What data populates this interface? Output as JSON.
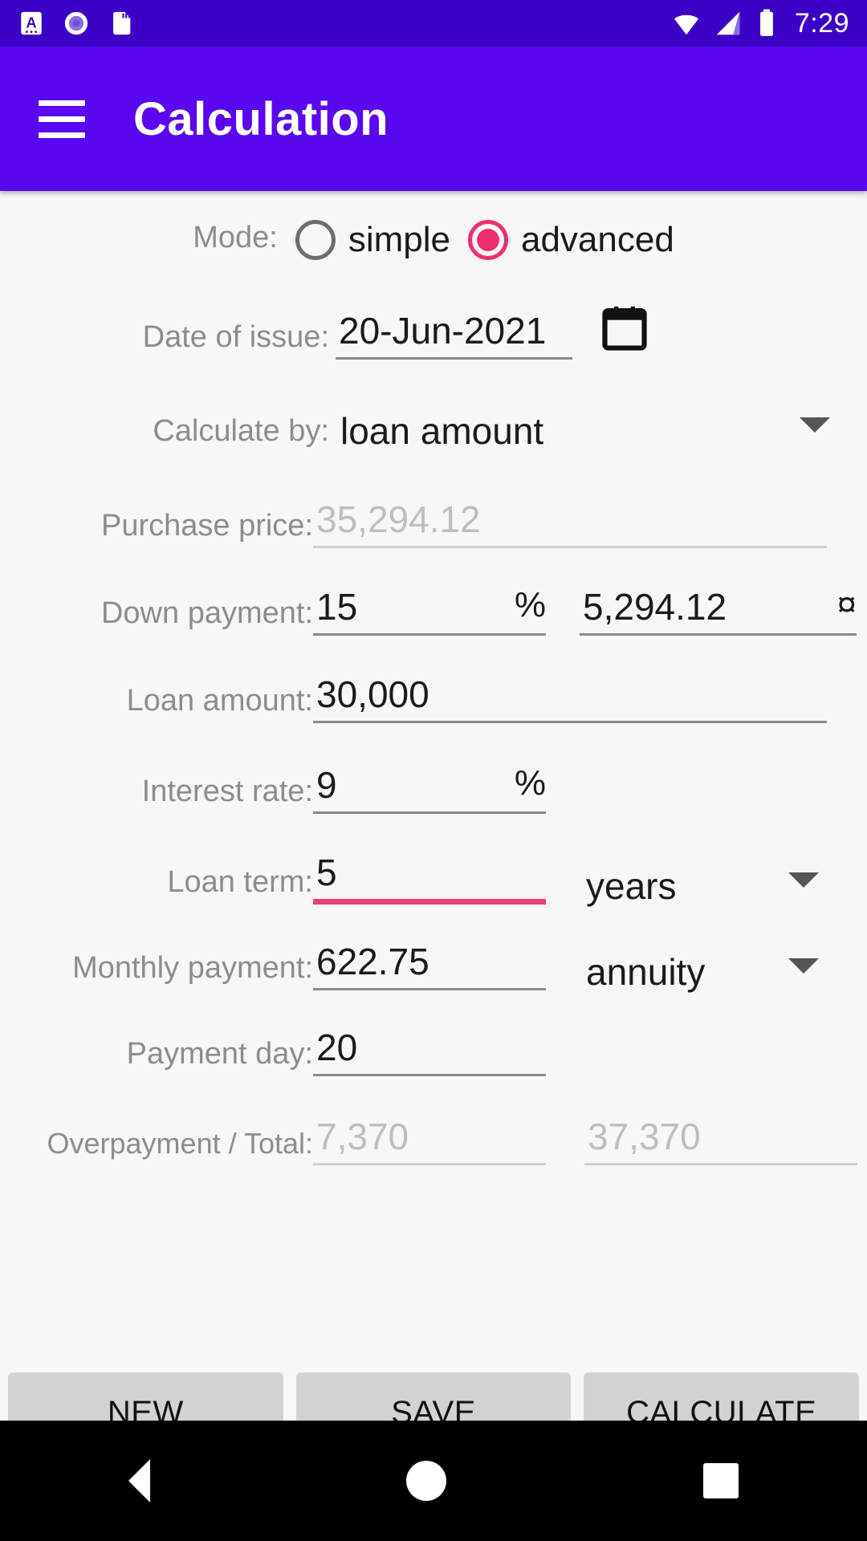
{
  "statusbar": {
    "time": "7:29",
    "icons": [
      "font-size-icon",
      "record-icon",
      "sd-card-icon"
    ],
    "right_icons": [
      "wifi-icon",
      "signal-icon",
      "battery-icon"
    ]
  },
  "appbar": {
    "menu_icon": "hamburger-menu-icon",
    "title": "Calculation"
  },
  "colors": {
    "statusbar_bg": "#3d00c7",
    "appbar_bg": "#5a06ef",
    "accent": "#ec407a",
    "radio_selected": "#f0306c",
    "label": "#8c8c8c",
    "disabled_value": "#bdbdbd"
  },
  "form": {
    "mode": {
      "label": "Mode:",
      "options": [
        {
          "label": "simple",
          "selected": false
        },
        {
          "label": "advanced",
          "selected": true
        }
      ]
    },
    "date_of_issue": {
      "label": "Date of issue:",
      "value": "20-Jun-2021",
      "icon": "calendar-icon"
    },
    "calculate_by": {
      "label": "Calculate by:",
      "value": "loan amount"
    },
    "purchase_price": {
      "label": "Purchase price:",
      "value": "35,294.12",
      "disabled": true
    },
    "down_payment": {
      "label": "Down payment:",
      "percent_value": "15",
      "percent_suffix": "%",
      "amount_value": "5,294.12",
      "amount_suffix": "¤"
    },
    "loan_amount": {
      "label": "Loan amount:",
      "value": "30,000"
    },
    "interest_rate": {
      "label": "Interest rate:",
      "value": "9",
      "suffix": "%"
    },
    "loan_term": {
      "label": "Loan term:",
      "value": "5",
      "unit": "years",
      "focused": true
    },
    "monthly_payment": {
      "label": "Monthly payment:",
      "value": "622.75",
      "type": "annuity"
    },
    "payment_day": {
      "label": "Payment day:",
      "value": "20"
    },
    "overpayment_total": {
      "label": "Overpayment / Total:",
      "overpayment": "7,370",
      "total": "37,370",
      "disabled": true
    }
  },
  "buttons": {
    "new": "NEW",
    "save": "SAVE",
    "calculate": "CALCULATE"
  },
  "navbar": {
    "back": "back-icon",
    "home": "home-icon",
    "recents": "recents-icon"
  }
}
